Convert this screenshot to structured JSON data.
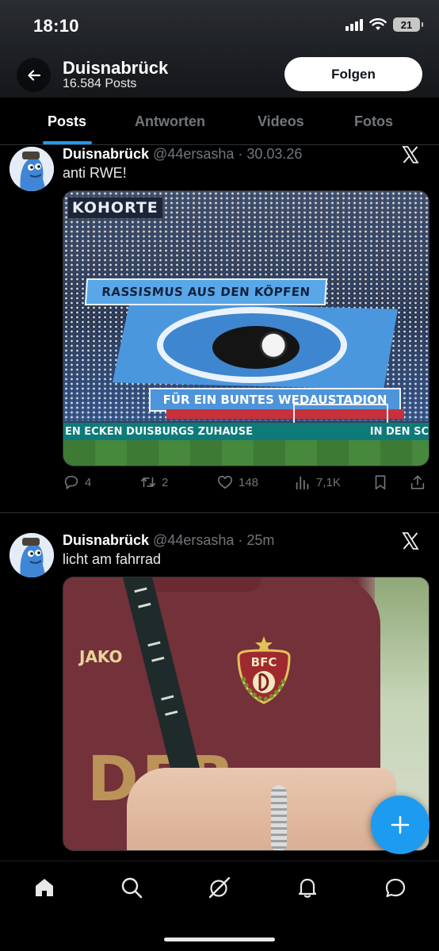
{
  "status_bar": {
    "time": "18:10",
    "battery": "21",
    "icons": [
      "signal-icon",
      "wifi-icon",
      "battery-icon"
    ]
  },
  "header": {
    "back_icon": "arrow-left-icon",
    "profile_name": "Duisnabrück",
    "post_count": "16.584 Posts",
    "follow_label": "Folgen"
  },
  "tabs": [
    {
      "label": "Posts",
      "active": true
    },
    {
      "label": "Antworten",
      "active": false
    },
    {
      "label": "Videos",
      "active": false
    },
    {
      "label": "Fotos",
      "active": false
    }
  ],
  "posts": [
    {
      "author": "Duisnabrück",
      "meta": "@44ersasha · 30.03.26",
      "text": "anti RWE!",
      "image": {
        "kohorte": "KOHORTE",
        "banner_top": "RASSISMUS AUS DEN KÖPFEN",
        "banner_bottom": "FÜR EIN BUNTES WEDAUSTADION",
        "board_left": "EN ECKEN DUISBURGS ZUHAUSE",
        "board_right": "IN DEN SC"
      },
      "replies": "4",
      "reposts": "2",
      "likes": "148",
      "views": "7,1K"
    },
    {
      "author": "Duisnabrück",
      "meta": "@44ersasha · 25m",
      "text": "licht am fahrrad",
      "image": {
        "brand": "JAKO",
        "crest": "BFC",
        "sponsor": "DEB"
      }
    }
  ],
  "bottom_nav": [
    "home-icon",
    "search-icon",
    "grok-icon",
    "notifications-icon",
    "messages-icon"
  ],
  "colors": {
    "accent": "#1d9bf0",
    "background": "#000000",
    "muted_text": "#71767b"
  }
}
